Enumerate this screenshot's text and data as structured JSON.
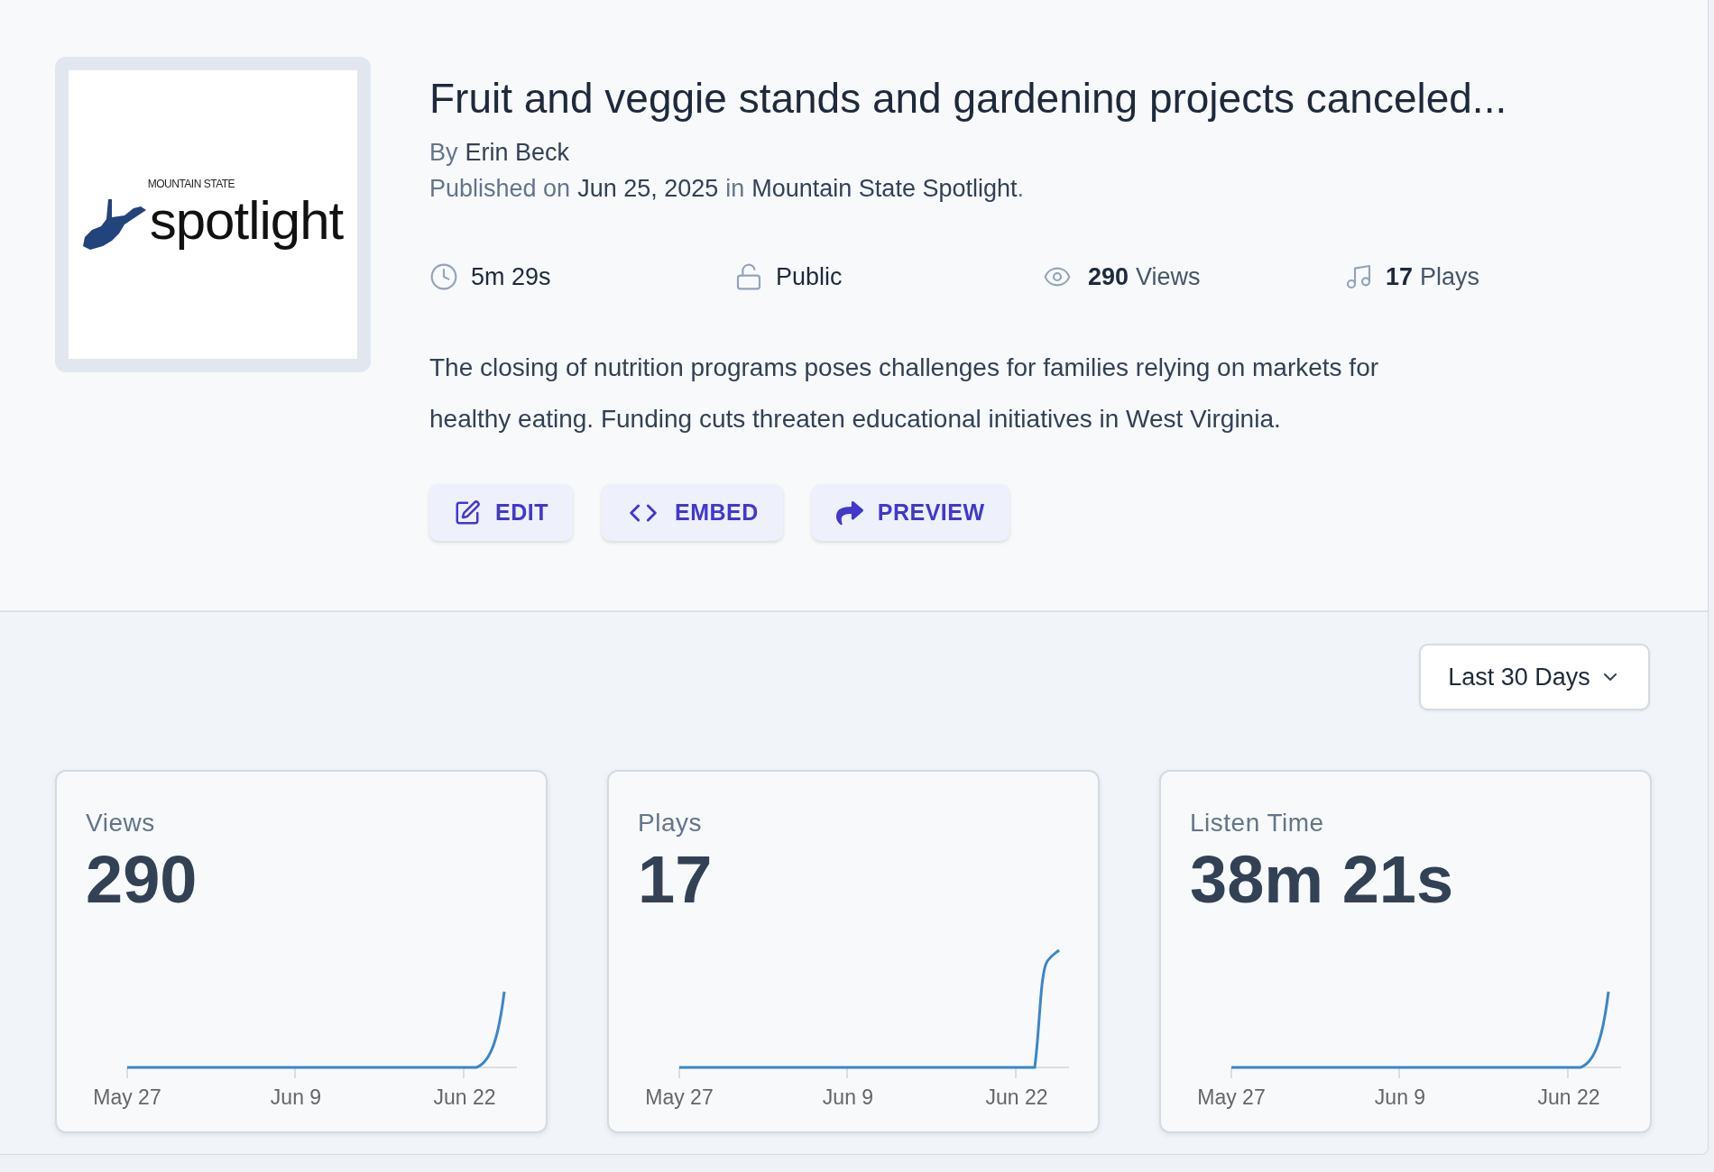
{
  "article": {
    "logo": {
      "kicker": "MOUNTAIN STATE",
      "wordmark": "spotlight"
    },
    "title": "Fruit and veggie stands and gardening projects canceled...",
    "byline": {
      "prefix": "By",
      "author": "Erin Beck"
    },
    "published": {
      "prefix": "Published on",
      "date": "Jun 25, 2025",
      "connector": "in",
      "publication": "Mountain State Spotlight",
      "suffix": "."
    },
    "stats": [
      {
        "kind": "duration",
        "value": "5m 29s"
      },
      {
        "kind": "visibility",
        "value": "Public"
      },
      {
        "kind": "views",
        "count": "290",
        "label": "Views"
      },
      {
        "kind": "plays",
        "count": "17",
        "label": "Plays"
      }
    ],
    "description": "The closing of nutrition programs poses challenges for families relying on markets for healthy eating. Funding cuts threaten educational initiatives in West Virginia.",
    "actions": [
      {
        "kind": "edit",
        "label": "EDIT"
      },
      {
        "kind": "embed",
        "label": "EMBED"
      },
      {
        "kind": "preview",
        "label": "PREVIEW"
      }
    ]
  },
  "range_select": {
    "value": "Last 30 Days"
  },
  "metric_cards": [
    {
      "kind": "views",
      "label": "Views",
      "value": "290",
      "x_labels": [
        "May 27",
        "Jun 9",
        "Jun 22"
      ]
    },
    {
      "kind": "plays",
      "label": "Plays",
      "value": "17",
      "x_labels": [
        "May 27",
        "Jun 9",
        "Jun 22"
      ]
    },
    {
      "kind": "listen_time",
      "label": "Listen Time",
      "value": "38m 21s",
      "x_labels": [
        "May 27",
        "Jun 9",
        "Jun 22"
      ]
    }
  ]
}
